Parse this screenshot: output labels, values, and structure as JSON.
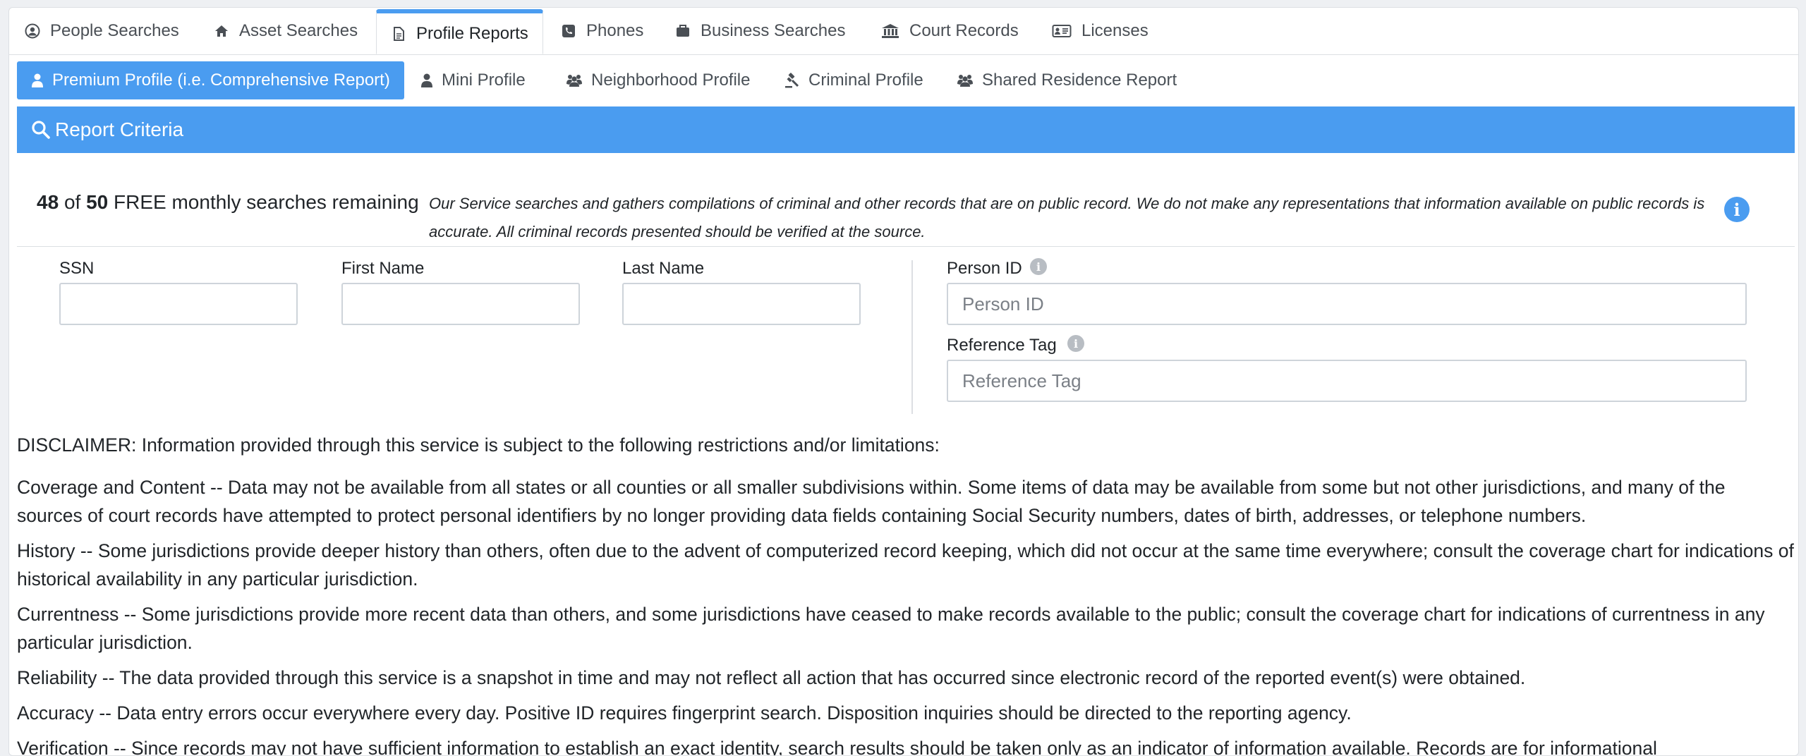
{
  "top_tabs": [
    {
      "label": "People Searches",
      "icon": "user-circle-icon"
    },
    {
      "label": "Asset Searches",
      "icon": "home-icon"
    },
    {
      "label": "Profile Reports",
      "icon": "file-icon"
    },
    {
      "label": "Phones",
      "icon": "phone-icon"
    },
    {
      "label": "Business Searches",
      "icon": "briefcase-icon"
    },
    {
      "label": "Court Records",
      "icon": "bank-icon"
    },
    {
      "label": "Licenses",
      "icon": "id-card-icon"
    }
  ],
  "sub_tabs": [
    {
      "label": "Premium Profile (i.e. Comprehensive Report)",
      "icon": "user-icon"
    },
    {
      "label": "Mini Profile",
      "icon": "user-icon"
    },
    {
      "label": "Neighborhood Profile",
      "icon": "users-icon"
    },
    {
      "label": "Criminal Profile",
      "icon": "gavel-icon"
    },
    {
      "label": "Shared Residence Report",
      "icon": "users-icon"
    }
  ],
  "criteria": {
    "title": "Report Criteria"
  },
  "searches": {
    "used": "48",
    "of": "of",
    "total": "50",
    "suffix": "FREE monthly searches remaining"
  },
  "notice": "Our Service searches and gathers compilations of criminal and other records that are on public record. We do not make any representations that information available on public records is accurate. All criminal records presented should be verified at the source.",
  "form": {
    "ssn_label": "SSN",
    "first_name_label": "First Name",
    "last_name_label": "Last Name",
    "person_id_label": "Person ID",
    "person_id_placeholder": "Person ID",
    "reference_tag_label": "Reference Tag",
    "reference_tag_placeholder": "Reference Tag"
  },
  "disclaimer": {
    "heading": "DISCLAIMER: Information provided through this service is subject to the following restrictions and/or limitations:",
    "coverage": "Coverage and Content -- Data may not be available from all states or all counties or all smaller subdivisions within. Some items of data may be available from some but not other jurisdictions, and many of the sources of court records have attempted to protect personal identifiers by no longer providing data fields containing Social Security numbers, dates of birth, addresses, or telephone numbers.",
    "history": "History -- Some jurisdictions provide deeper history than others, often due to the advent of computerized record keeping, which did not occur at the same time everywhere; consult the coverage chart for indications of historical availability in any particular jurisdiction.",
    "currentness": "Currentness -- Some jurisdictions provide more recent data than others, and some jurisdictions have ceased to make records available to the public; consult the coverage chart for indications of currentness in any particular jurisdiction.",
    "reliability": "Reliability -- The data provided through this service is a snapshot in time and may not reflect all action that has occurred since electronic record of the reported event(s) were obtained.",
    "accuracy": "Accuracy -- Data entry errors occur everywhere every day. Positive ID requires fingerprint search. Disposition inquiries should be directed to the reporting agency.",
    "verification": "Verification -- Since records may not have sufficient information to establish an exact identity, search results should be taken only as an indicator of information available. Records are for informational"
  },
  "colors": {
    "accent": "#4a9cf0",
    "border": "#dcdfe3"
  }
}
